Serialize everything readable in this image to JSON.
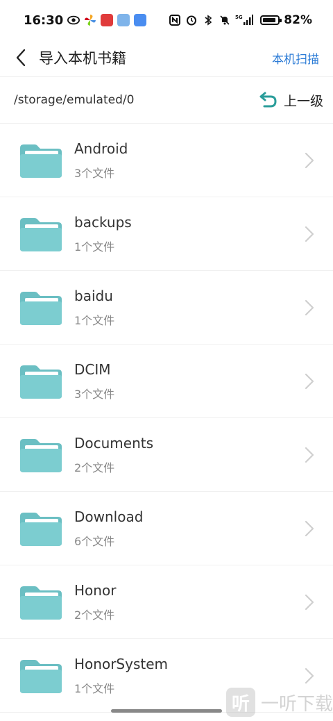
{
  "status_bar": {
    "time": "16:30",
    "network": "5G",
    "battery_percent_label": "82%",
    "battery_level": 0.82
  },
  "nav": {
    "title": "导入本机书籍",
    "action_label": "本机扫描"
  },
  "path_bar": {
    "path": "/storage/emulated/0",
    "up_label": "上一级"
  },
  "folders": [
    {
      "name": "Android",
      "count": "3个文件"
    },
    {
      "name": "backups",
      "count": "1个文件"
    },
    {
      "name": "baidu",
      "count": "1个文件"
    },
    {
      "name": "DCIM",
      "count": "3个文件"
    },
    {
      "name": "Documents",
      "count": "2个文件"
    },
    {
      "name": "Download",
      "count": "6个文件"
    },
    {
      "name": "Honor",
      "count": "2个文件"
    },
    {
      "name": "HonorSystem",
      "count": "1个文件"
    }
  ],
  "watermark": {
    "glyph": "听",
    "text": "一听下载"
  },
  "colors": {
    "accent": "#2b7bd6",
    "folder": "#7ccdd0",
    "folder_dark": "#6bbfc3",
    "folder_paper": "#ffffff",
    "up_arrow": "#2a9d9a"
  }
}
